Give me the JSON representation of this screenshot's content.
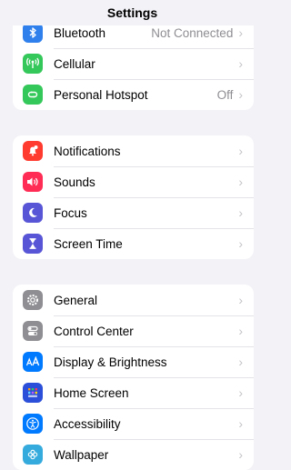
{
  "header": {
    "title": "Settings"
  },
  "groups": [
    {
      "rows": [
        {
          "label": "Bluetooth",
          "value": "Not Connected",
          "icon": "bluetooth-icon",
          "color": "#2f80ed"
        },
        {
          "label": "Cellular",
          "value": "",
          "icon": "antenna-icon",
          "color": "#34c759"
        },
        {
          "label": "Personal Hotspot",
          "value": "Off",
          "icon": "link-icon",
          "color": "#34c759"
        }
      ]
    },
    {
      "rows": [
        {
          "label": "Notifications",
          "icon": "bell-icon",
          "color": "#ff3b30"
        },
        {
          "label": "Sounds",
          "icon": "speaker-icon",
          "color": "#ff2d55"
        },
        {
          "label": "Focus",
          "icon": "moon-icon",
          "color": "#5856d6"
        },
        {
          "label": "Screen Time",
          "icon": "hourglass-icon",
          "color": "#5856d6"
        }
      ]
    },
    {
      "rows": [
        {
          "label": "General",
          "icon": "gear-icon",
          "color": "#8e8e93"
        },
        {
          "label": "Control Center",
          "icon": "toggles-icon",
          "color": "#8e8e93"
        },
        {
          "label": "Display & Brightness",
          "icon": "text-size-icon",
          "color": "#007aff"
        },
        {
          "label": "Home Screen",
          "icon": "app-grid-icon",
          "color": "#2b4fd8"
        },
        {
          "label": "Accessibility",
          "icon": "accessibility-icon",
          "color": "#007aff"
        },
        {
          "label": "Wallpaper",
          "icon": "flower-icon",
          "color": "#35aadc"
        }
      ]
    }
  ]
}
